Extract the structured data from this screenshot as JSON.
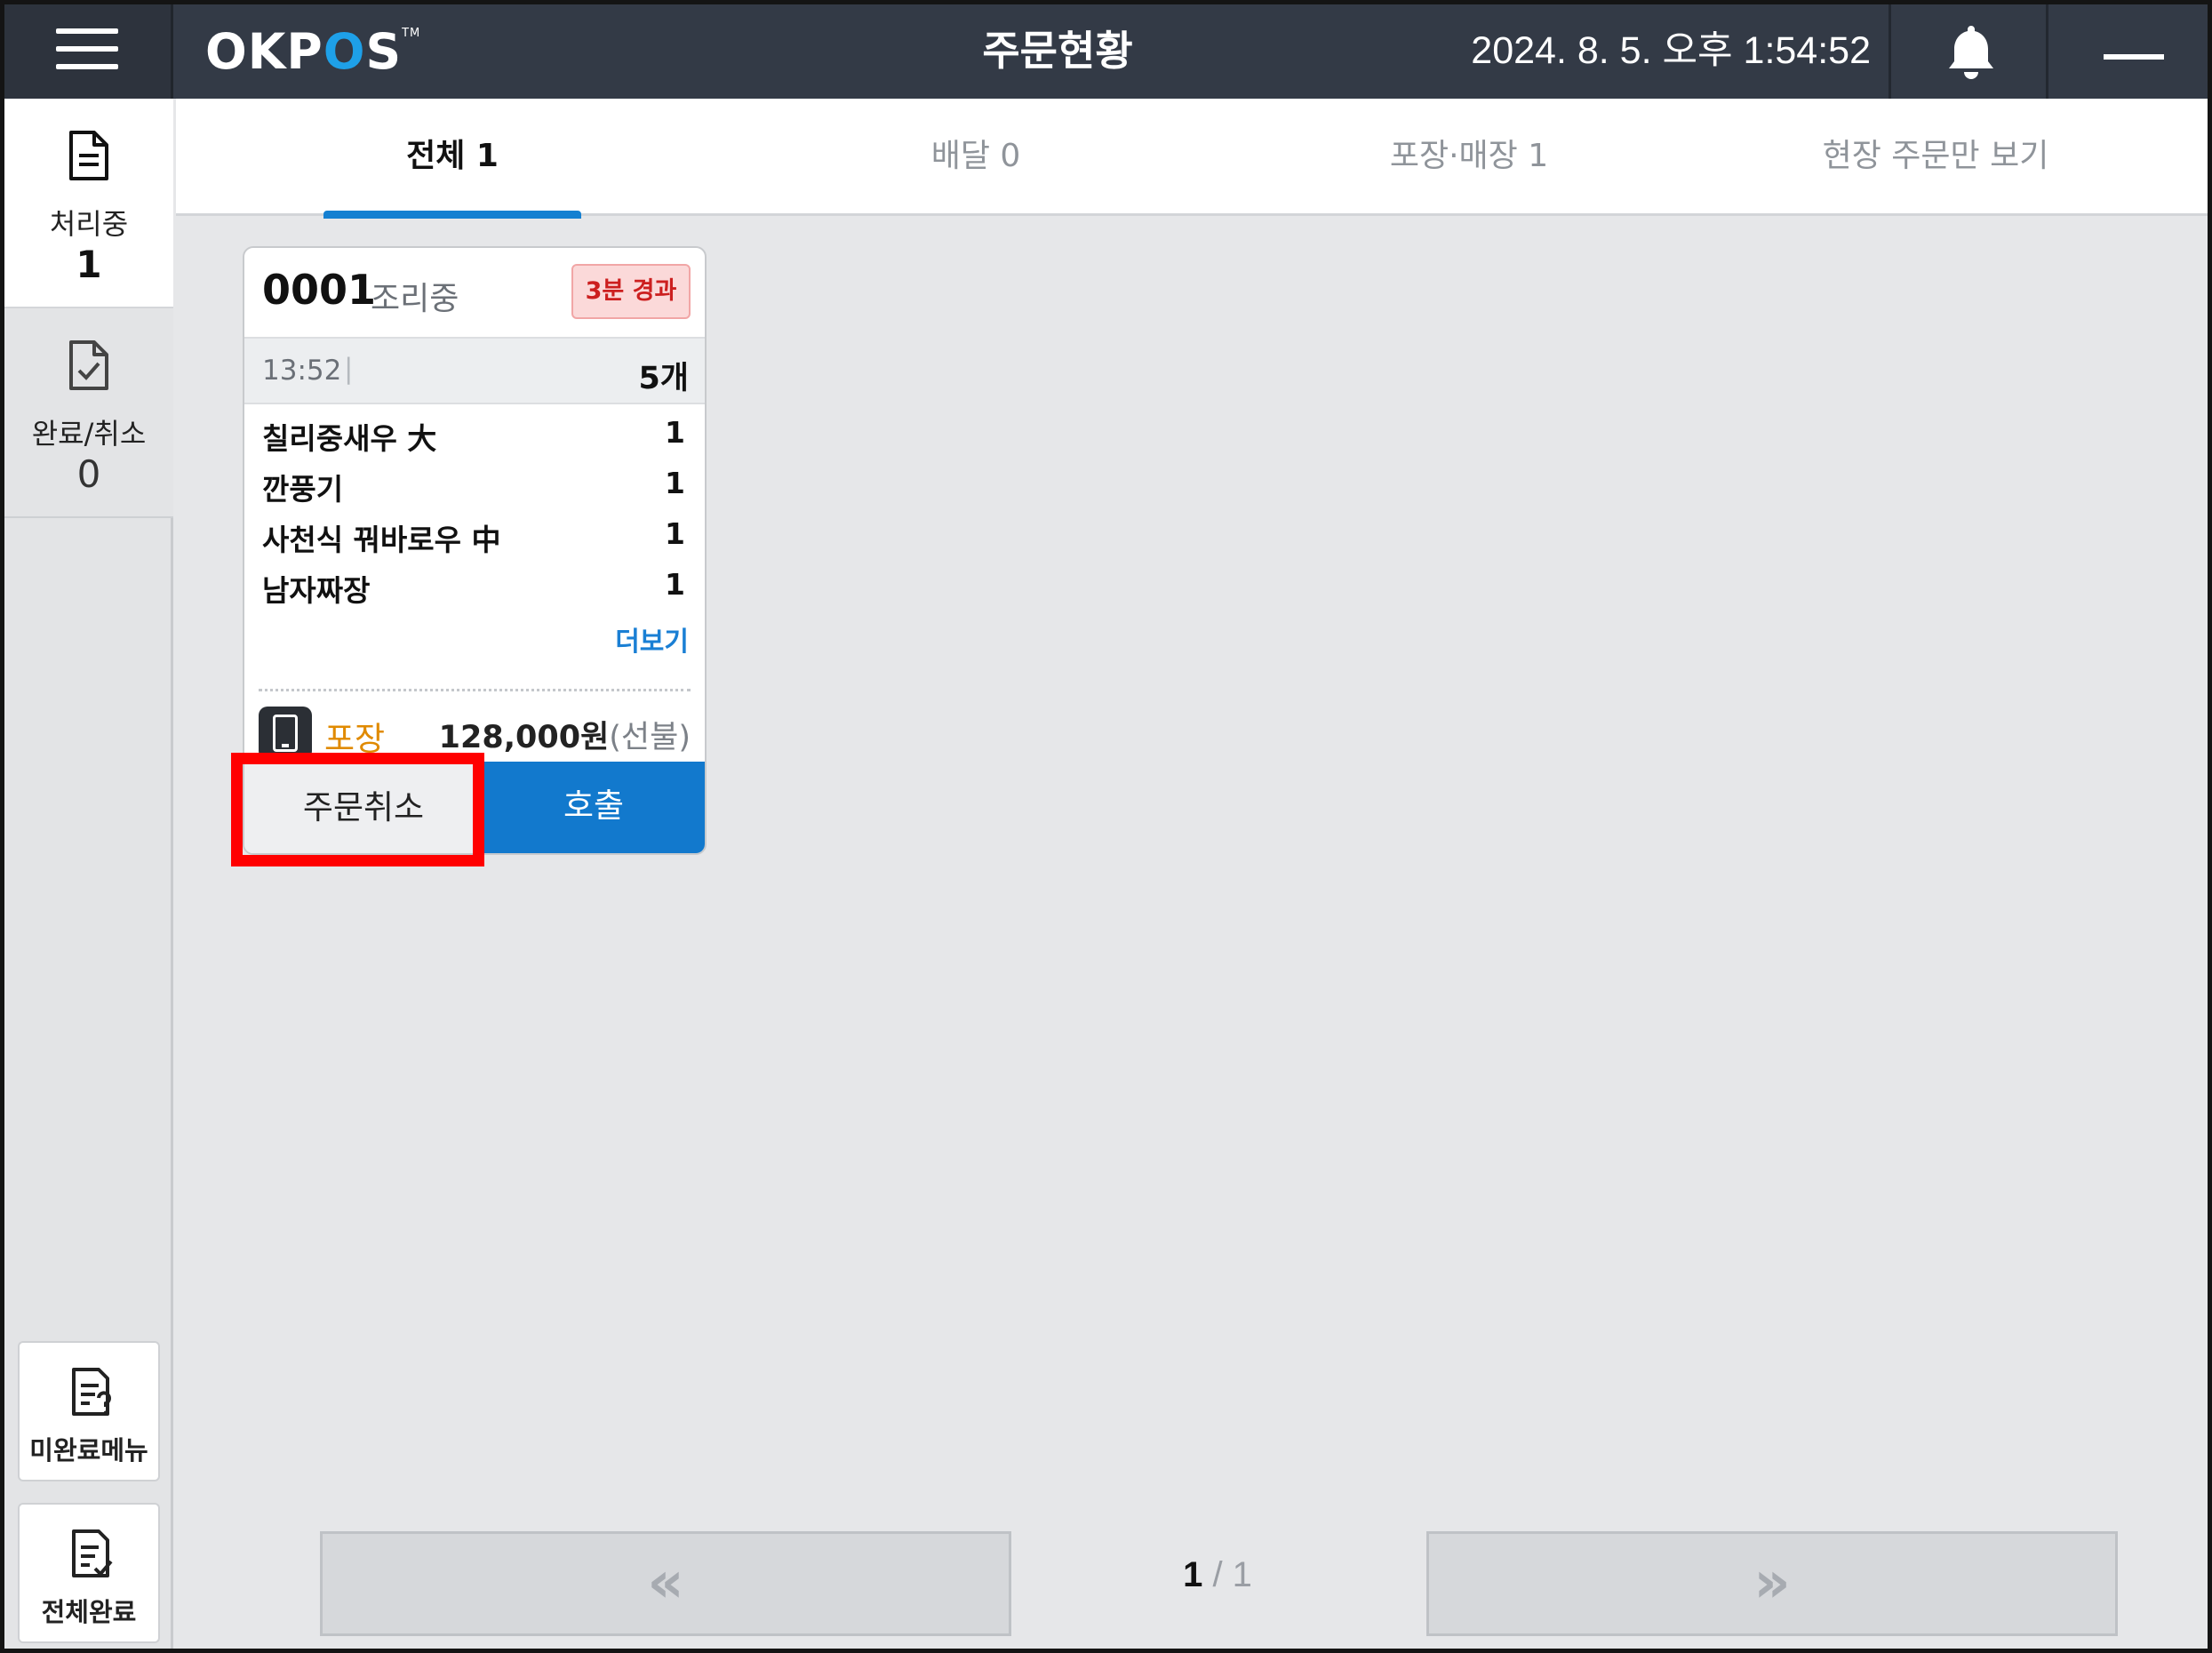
{
  "header": {
    "logo": "OKPOS",
    "title": "주문현황",
    "datetime": "2024. 8. 5. 오후 1:54:52"
  },
  "sidebar": {
    "processing": {
      "label": "처리중",
      "count": "1"
    },
    "done": {
      "label": "완료/취소",
      "count": "0"
    },
    "unfinished_menu_label": "미완료메뉴",
    "all_complete_label": "전체완료"
  },
  "filters": {
    "all": "전체 1",
    "delivery": "배달 0",
    "takeout": "포장·매장 1",
    "onsite": "현장 주문만 보기"
  },
  "order": {
    "number": "0001",
    "status": "조리중",
    "elapsed": "3분 경과",
    "time": "13:52",
    "time_sep": "|",
    "item_count": "5개",
    "items": [
      {
        "name": "칠리중새우 大",
        "qty": "1"
      },
      {
        "name": "깐풍기",
        "qty": "1"
      },
      {
        "name": "사천식 꿔바로우 中",
        "qty": "1"
      },
      {
        "name": "남자짜장",
        "qty": "1"
      }
    ],
    "more": "더보기",
    "type": "포장",
    "price": "128,000원",
    "payment": "(선불)",
    "cancel_label": "주문취소",
    "call_label": "호출"
  },
  "pagination": {
    "prev": "«",
    "next": "»",
    "current": "1",
    "sep": " / ",
    "total": "1"
  },
  "colors": {
    "header_bg": "#333a46",
    "accent_blue": "#1279cd",
    "badge_red": "#cc1f1f",
    "takeout_orange": "#e08a00",
    "highlight": "#ff0000"
  }
}
